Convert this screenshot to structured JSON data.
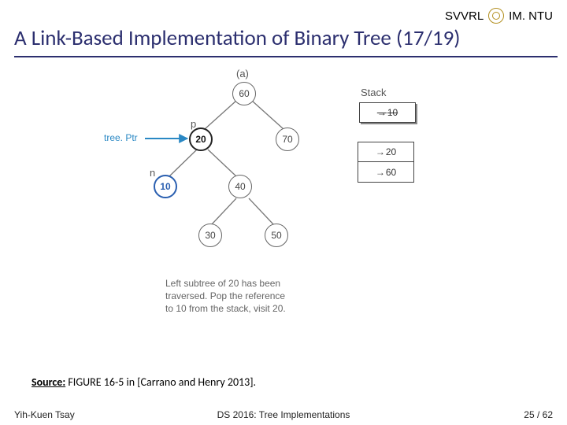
{
  "header": {
    "org_left": "SVVRL",
    "org_right": "IM. NTU",
    "title": "A Link-Based Implementation of Binary Tree (17/19)"
  },
  "figure": {
    "panel_label": "(a)",
    "tree_ptr_label": "tree. Ptr",
    "p_label": "p",
    "n_label": "n",
    "nodes": {
      "n60": "60",
      "n20": "20",
      "n70": "70",
      "n10": "10",
      "n40": "40",
      "n30": "30",
      "n50": "50"
    },
    "stack_label": "Stack",
    "stack": [
      "10",
      "20",
      "60"
    ],
    "caption_l1": "Left subtree of 20 has been",
    "caption_l2": "traversed. Pop the reference",
    "caption_l3": "to 10 from the stack, visit 20."
  },
  "source": {
    "label": "Source:",
    "text": "FIGURE 16-5 in [Carrano and Henry 2013]."
  },
  "footer": {
    "left": "Yih-Kuen Tsay",
    "center": "DS 2016: Tree Implementations",
    "page_cur": "25",
    "page_sep": " / ",
    "page_total": "62"
  }
}
